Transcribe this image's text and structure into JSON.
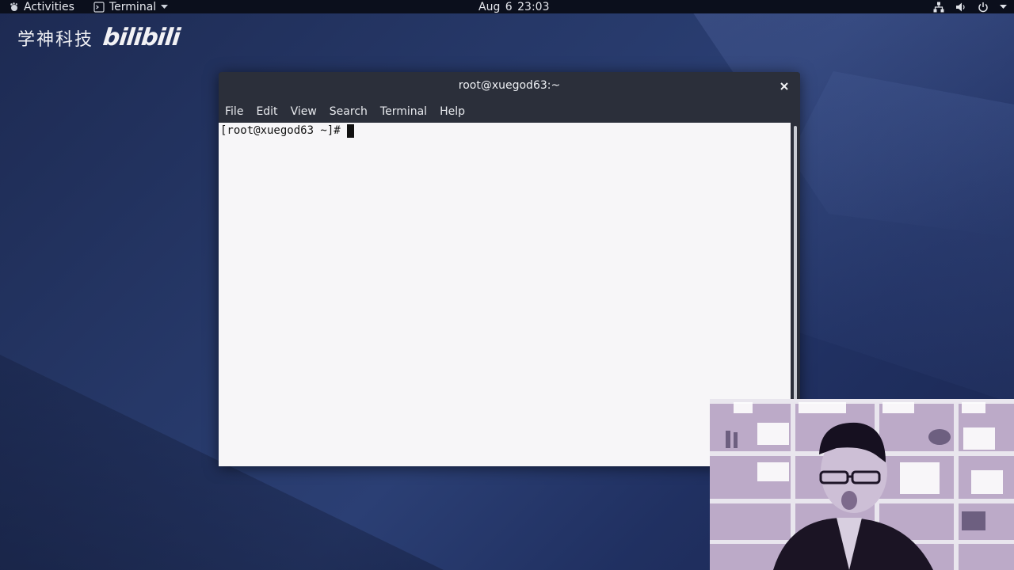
{
  "topbar": {
    "activities_label": "Activities",
    "app_menu_label": "Terminal",
    "clock": "Aug 6  23:03",
    "icons": [
      "network-icon",
      "volume-icon",
      "power-icon",
      "chevron-down-icon"
    ]
  },
  "watermark": {
    "chinese_text": "学神科技",
    "logo_text": "bilibili"
  },
  "window": {
    "title": "root@xuegod63:~",
    "menu": [
      "File",
      "Edit",
      "View",
      "Search",
      "Terminal",
      "Help"
    ],
    "terminal": {
      "prompt": "[root@xuegod63 ~]#"
    }
  },
  "colors": {
    "desktop": "#263868",
    "topbar": "#0b0f1c",
    "window_chrome": "#2b2f3a",
    "terminal_bg": "#f7f6f8",
    "terminal_fg": "#121212"
  }
}
